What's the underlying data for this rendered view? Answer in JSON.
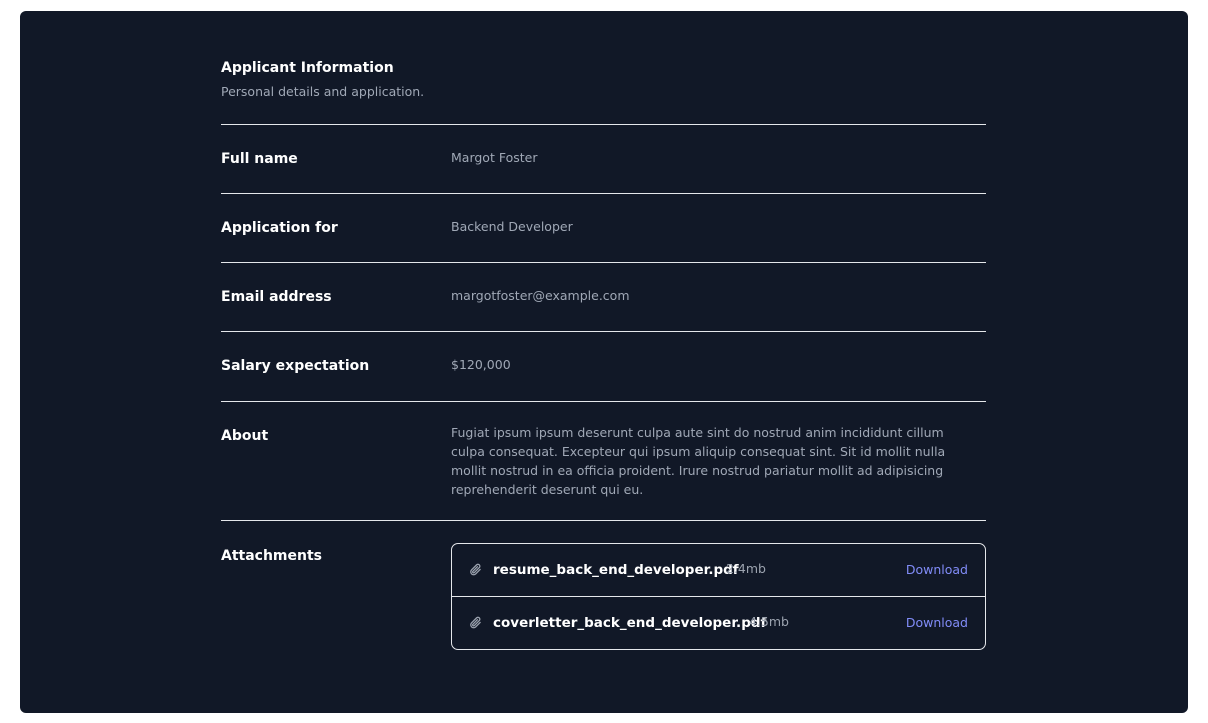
{
  "header": {
    "title": "Applicant Information",
    "subtitle": "Personal details and application."
  },
  "fields": [
    {
      "label": "Full name",
      "value": "Margot Foster"
    },
    {
      "label": "Application for",
      "value": "Backend Developer"
    },
    {
      "label": "Email address",
      "value": "margotfoster@example.com"
    },
    {
      "label": "Salary expectation",
      "value": "$120,000"
    },
    {
      "label": "About",
      "value": "Fugiat ipsum ipsum deserunt culpa aute sint do nostrud anim incididunt cillum culpa consequat. Excepteur qui ipsum aliquip consequat sint. Sit id mollit nulla mollit nostrud in ea officia proident. Irure nostrud pariatur mollit ad adipisicing reprehenderit deserunt qui eu."
    }
  ],
  "attachments": {
    "label": "Attachments",
    "files": [
      {
        "name": "resume_back_end_developer.pdf",
        "size": "2.4mb",
        "action": "Download",
        "icon": "paperclip-icon"
      },
      {
        "name": "coverletter_back_end_developer.pdf",
        "size": "4.5mb",
        "action": "Download",
        "icon": "paperclip-icon"
      }
    ]
  },
  "colors": {
    "panel_bg": "#111827",
    "divider": "#e5e7eb",
    "label": "#ffffff",
    "value": "#a0a8b6",
    "link": "#818cf8"
  }
}
